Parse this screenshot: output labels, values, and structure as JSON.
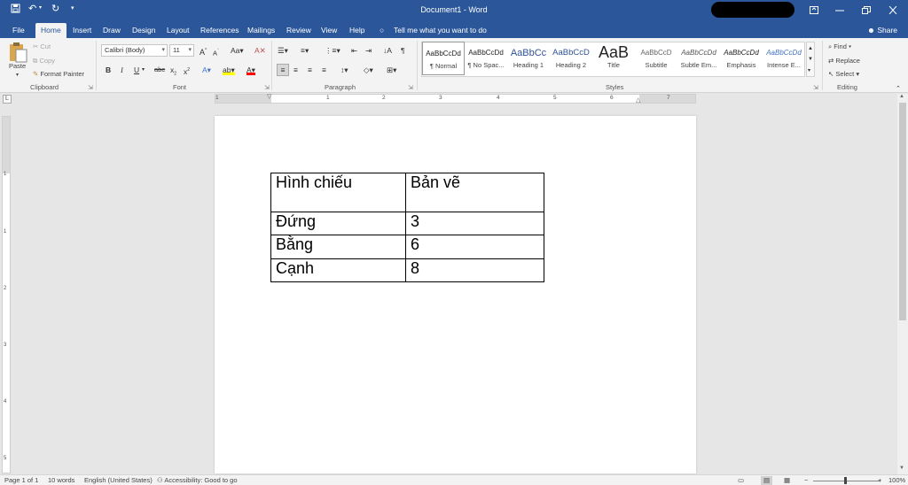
{
  "titlebar": {
    "title": "Document1  -  Word",
    "save_icon": "save-icon",
    "undo_icon": "undo-icon",
    "redo_icon": "redo-icon",
    "customize_icon": "customize-qat-icon"
  },
  "tabs": [
    "File",
    "Home",
    "Insert",
    "Draw",
    "Design",
    "Layout",
    "References",
    "Mailings",
    "Review",
    "View",
    "Help"
  ],
  "tell_me": "Tell me what you want to do",
  "share": "Share",
  "clipboard": {
    "paste": "Paste",
    "cut": "Cut",
    "copy": "Copy",
    "format_painter": "Format Painter",
    "label": "Clipboard"
  },
  "font": {
    "name": "Calibri (Body)",
    "size": "11",
    "label": "Font"
  },
  "paragraph": {
    "label": "Paragraph"
  },
  "styles": {
    "label": "Styles",
    "items": [
      {
        "sample": "AaBbCcDd",
        "name": "¶ Normal"
      },
      {
        "sample": "AaBbCcDd",
        "name": "¶ No Spac..."
      },
      {
        "sample": "AaBbCc",
        "name": "Heading 1"
      },
      {
        "sample": "AaBbCcD",
        "name": "Heading 2"
      },
      {
        "sample": "AaB",
        "name": "Title"
      },
      {
        "sample": "AaBbCcD",
        "name": "Subtitle"
      },
      {
        "sample": "AaBbCcDd",
        "name": "Subtle Em..."
      },
      {
        "sample": "AaBbCcDd",
        "name": "Emphasis"
      },
      {
        "sample": "AaBbCcDd",
        "name": "Intense E..."
      }
    ]
  },
  "editing": {
    "find": "Find",
    "replace": "Replace",
    "select": "Select",
    "label": "Editing"
  },
  "ruler": {
    "h_numbers": [
      "1",
      "1",
      "2",
      "3",
      "4",
      "5",
      "6",
      "7"
    ],
    "v_numbers": [
      "1",
      "1",
      "2",
      "3",
      "4",
      "5"
    ]
  },
  "table": {
    "rows": [
      [
        "Hình chiếu",
        "Bản vẽ"
      ],
      [
        "Đứng",
        "3"
      ],
      [
        "Bằng",
        "6"
      ],
      [
        "Cạnh",
        "8"
      ]
    ]
  },
  "status": {
    "page": "Page 1 of 1",
    "words": "10 words",
    "language": "English (United States)",
    "accessibility": "Accessibility: Good to go",
    "zoom": "100%"
  },
  "colors": {
    "brand": "#2b579a",
    "ribbon": "#f3f3f3",
    "canvas": "#e6e6e6"
  }
}
